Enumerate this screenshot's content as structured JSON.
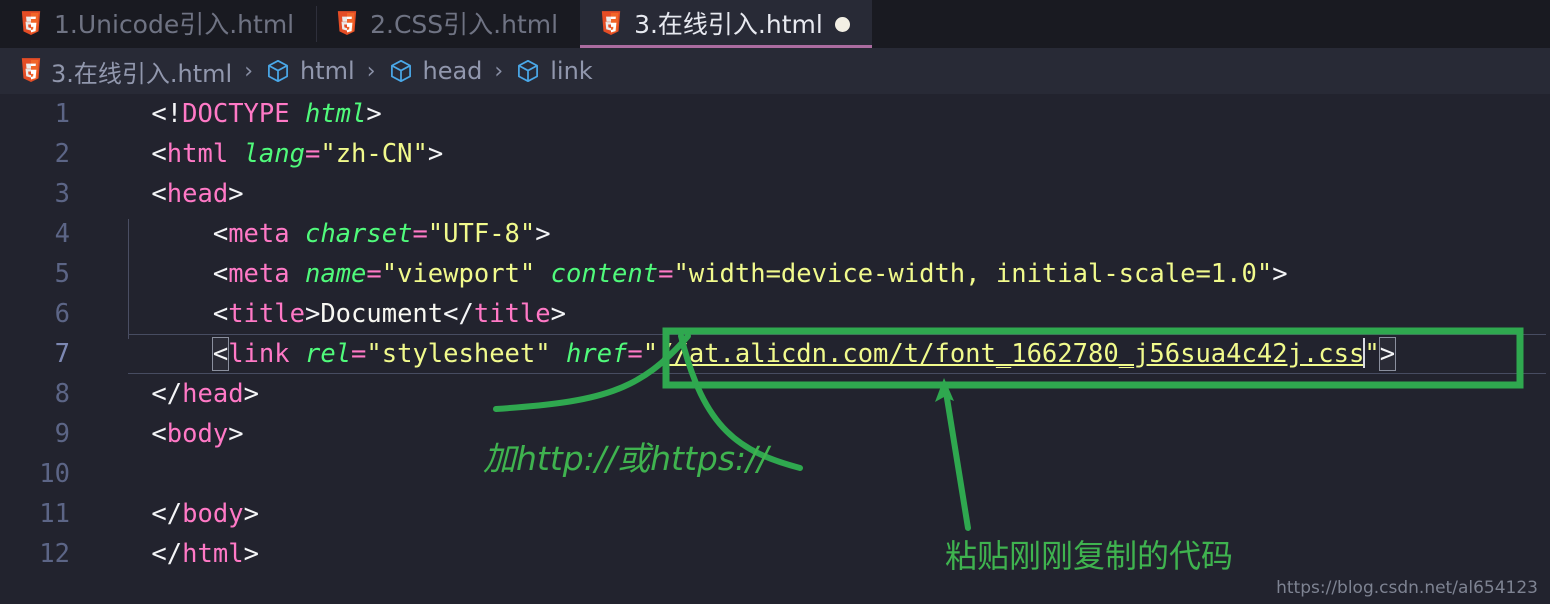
{
  "window": {
    "app": "vscode-editor",
    "theme_colors": {
      "tabbar_bg": "#191a21",
      "active_tab_bg": "#282a36",
      "active_tab_border": "#ab6ca0",
      "editor_bg": "#22232e",
      "breadcrumb_bg": "#282a36",
      "annotation_green": "#3fb34f",
      "tag_pink": "#ff79c6",
      "attr_green": "#50fa7b",
      "string_yellow": "#f1fa8c",
      "linenum_blue": "#5c6586"
    }
  },
  "tabs": [
    {
      "label": "1.Unicode引入.html",
      "icon": "html5-icon",
      "active": false,
      "dirty": false
    },
    {
      "label": "2.CSS引入.html",
      "icon": "html5-icon",
      "active": false,
      "dirty": false
    },
    {
      "label": "3.在线引入.html",
      "icon": "html5-icon",
      "active": true,
      "dirty": true
    }
  ],
  "breadcrumb": {
    "items": [
      {
        "label": "3.在线引入.html",
        "icon": "html5-icon"
      },
      {
        "label": "html",
        "icon": "symbol-cube-icon"
      },
      {
        "label": "head",
        "icon": "symbol-cube-icon"
      },
      {
        "label": "link",
        "icon": "symbol-cube-icon"
      }
    ],
    "separator": "›"
  },
  "editor": {
    "language": "html",
    "current_line": 7,
    "lines": [
      {
        "n": "1",
        "text": "<!DOCTYPE html>"
      },
      {
        "n": "2",
        "text": "<html lang=\"zh-CN\">"
      },
      {
        "n": "3",
        "text": "<head>"
      },
      {
        "n": "4",
        "text": "    <meta charset=\"UTF-8\">"
      },
      {
        "n": "5",
        "text": "    <meta name=\"viewport\" content=\"width=device-width, initial-scale=1.0\">"
      },
      {
        "n": "6",
        "text": "    <title>Document</title>"
      },
      {
        "n": "7",
        "text": "    <link rel=\"stylesheet\" href=\"//at.alicdn.com/t/font_1662780_j56sua4c42j.css\">"
      },
      {
        "n": "8",
        "text": "</head>"
      },
      {
        "n": "9",
        "text": "<body>"
      },
      {
        "n": "10",
        "text": ""
      },
      {
        "n": "11",
        "text": "</body>"
      },
      {
        "n": "12",
        "text": "</html>"
      }
    ],
    "line7_tokens": {
      "indent": "    ",
      "open_bracket": "<",
      "tag": "link",
      "attr1": "rel",
      "eq": "=",
      "val1": "\"stylesheet\"",
      "attr2": "href",
      "quote_open": "\"",
      "url": "//at.alicdn.com/t/font_1662780_j56sua4c42j.css",
      "quote_close": "\"",
      "close_bracket": ">"
    }
  },
  "annotations": [
    {
      "id": "annotation-protocol",
      "text": "加http://或https://"
    },
    {
      "id": "annotation-paste",
      "text": "粘贴刚刚复制的代码"
    }
  ],
  "watermark": {
    "text": "https://blog.csdn.net/al654123"
  }
}
